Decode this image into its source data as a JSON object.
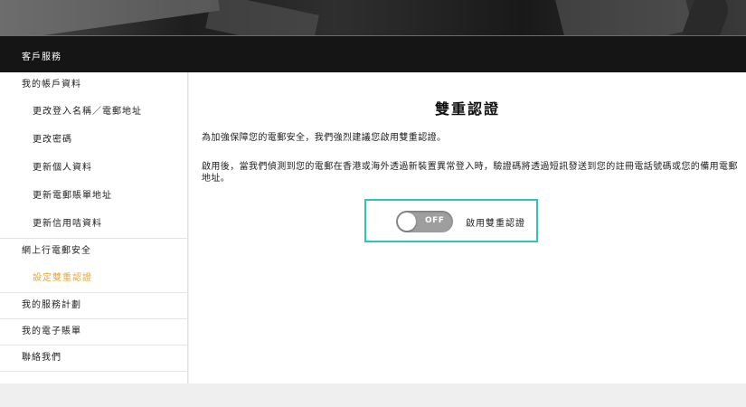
{
  "header": {
    "title": "客戶服務"
  },
  "sidebar": {
    "groups": [
      {
        "label": "我的帳戶資料",
        "items": [
          "更改登入名稱／電郵地址",
          "更改密碼",
          "更新個人資料",
          "更新電郵賬單地址",
          "更新信用咭資料"
        ]
      },
      {
        "label": "網上行電郵安全",
        "items": [
          "設定雙重認證"
        ]
      },
      {
        "label": "我的服務計劃",
        "items": []
      },
      {
        "label": "我的電子賬單",
        "items": []
      },
      {
        "label": "聯絡我們",
        "items": []
      }
    ],
    "active_item": "設定雙重認證"
  },
  "main": {
    "title": "雙重認證",
    "intro": "為加強保障您的電郵安全，我們強烈建議您啟用雙重認證。",
    "description": "啟用後，當我們偵測到您的電郵在香港或海外透過新裝置異常登入時，驗證碼將透過短訊發送到您的註冊電話號碼或您的備用電郵地址。",
    "toggle": {
      "state_text": "OFF",
      "label": "啟用雙重認證",
      "on": false
    }
  },
  "colors": {
    "accent": "#e8a534",
    "highlight_border": "#2ec4b6",
    "header_bg": "#151515"
  }
}
